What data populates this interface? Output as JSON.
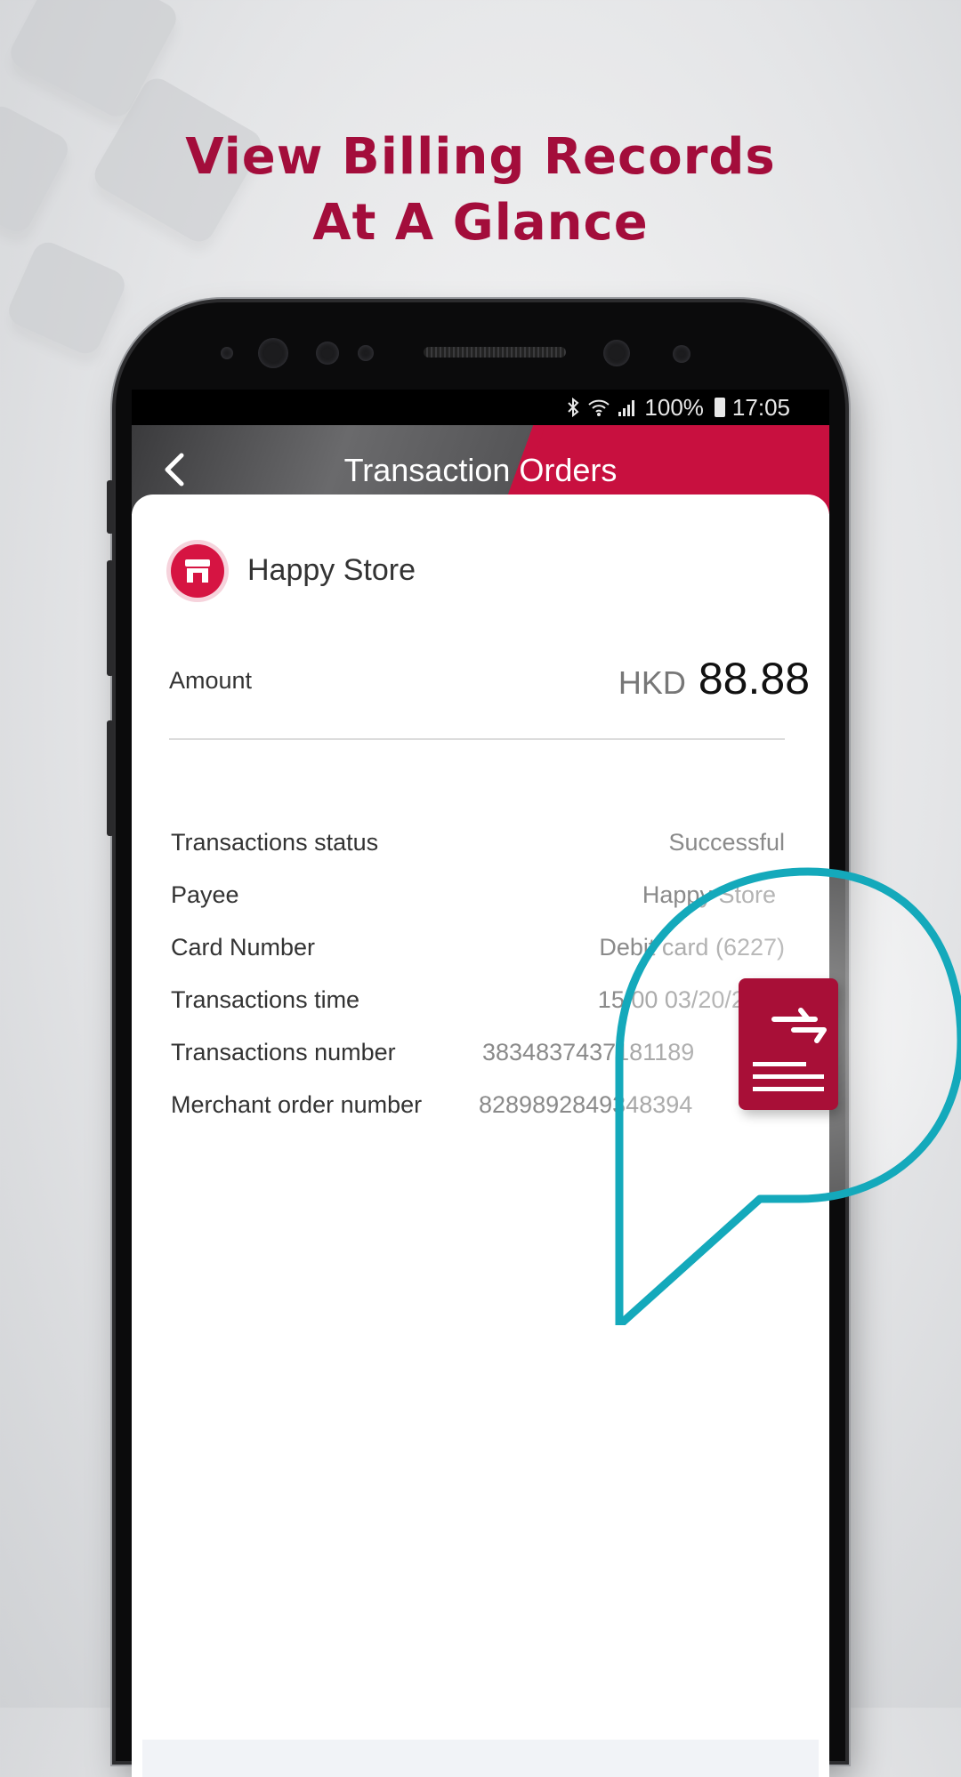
{
  "headline": {
    "line1": "View Billing Records",
    "line2": "At A Glance"
  },
  "status_bar": {
    "battery": "100%",
    "time": "17:05"
  },
  "app_bar": {
    "title": "Transaction Orders"
  },
  "merchant": {
    "name": "Happy Store"
  },
  "amount": {
    "label": "Amount",
    "currency": "HKD",
    "value": "88.88"
  },
  "details": [
    {
      "label": "Transactions status",
      "value": "Successful"
    },
    {
      "label": "Payee",
      "value": "Happy Store"
    },
    {
      "label": "Card Number",
      "value": "Debit card (6227)"
    },
    {
      "label": "Transactions time",
      "value": "15:00 03/20/2017"
    },
    {
      "label": "Transactions number",
      "value": "3834837437181189"
    },
    {
      "label": "Merchant order number",
      "value": "8289892849348394"
    }
  ],
  "colors": {
    "brand_red": "#c8103f",
    "headline": "#a30d3b",
    "bubble": "#14a9bb"
  },
  "icons": [
    "back-arrow-icon",
    "store-icon",
    "bluetooth-icon",
    "wifi-icon",
    "signal-icon",
    "battery-icon",
    "billing-document-icon"
  ]
}
